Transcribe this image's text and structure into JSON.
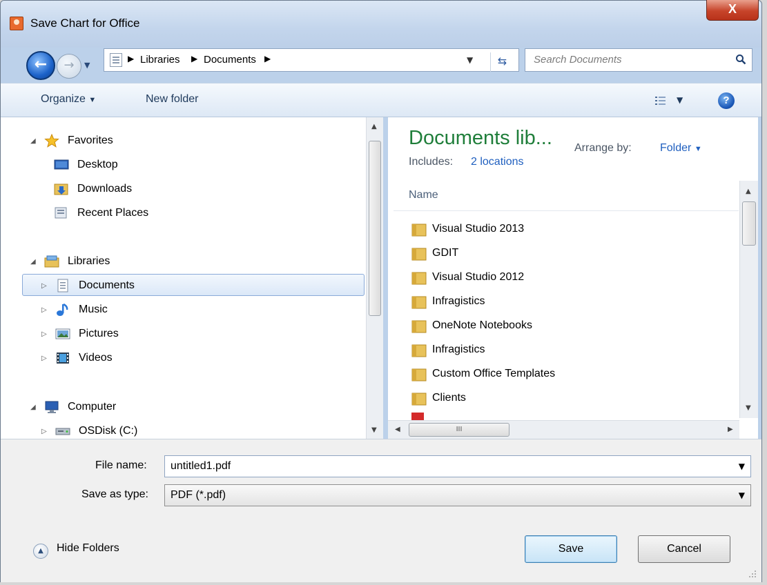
{
  "window": {
    "title": "Save Chart for Office",
    "close_label": "X"
  },
  "nav": {
    "breadcrumbs": [
      "Libraries",
      "Documents"
    ],
    "search_placeholder": "Search Documents"
  },
  "toolbar": {
    "organize_label": "Organize",
    "new_folder_label": "New folder",
    "help_label": "?"
  },
  "sidebar": {
    "favorites": {
      "label": "Favorites",
      "items": [
        {
          "label": "Desktop",
          "icon": "desktop-icon"
        },
        {
          "label": "Downloads",
          "icon": "downloads-folder-icon"
        },
        {
          "label": "Recent Places",
          "icon": "recent-places-icon"
        }
      ]
    },
    "libraries": {
      "label": "Libraries",
      "items": [
        {
          "label": "Documents",
          "icon": "documents-icon",
          "selected": true
        },
        {
          "label": "Music",
          "icon": "music-icon"
        },
        {
          "label": "Pictures",
          "icon": "pictures-icon"
        },
        {
          "label": "Videos",
          "icon": "videos-icon"
        }
      ]
    },
    "computer": {
      "label": "Computer",
      "items": [
        {
          "label": "OSDisk (C:)",
          "icon": "disk-drive-icon"
        }
      ]
    }
  },
  "library": {
    "title": "Documents lib...",
    "includes_label": "Includes:",
    "includes_link": "2 locations",
    "arrange_label": "Arrange by:",
    "arrange_value": "Folder"
  },
  "file_list": {
    "column_header": "Name",
    "items": [
      "Visual Studio 2013",
      "GDIT",
      "Visual Studio 2012",
      "Infragistics",
      "OneNote Notebooks",
      "Infragistics",
      "Custom Office Templates",
      "Clients"
    ],
    "hscroll_grip": "III"
  },
  "form": {
    "file_name_label": "File name:",
    "file_name_value": "untitled1.pdf",
    "save_type_label": "Save as type:",
    "save_type_value": "PDF (*.pdf)"
  },
  "footer": {
    "hide_folders_label": "Hide Folders",
    "save_label": "Save",
    "cancel_label": "Cancel"
  },
  "colors": {
    "accent": "#1f5fbf",
    "library_title": "#1f7e3a",
    "close_button": "#c7442a"
  }
}
